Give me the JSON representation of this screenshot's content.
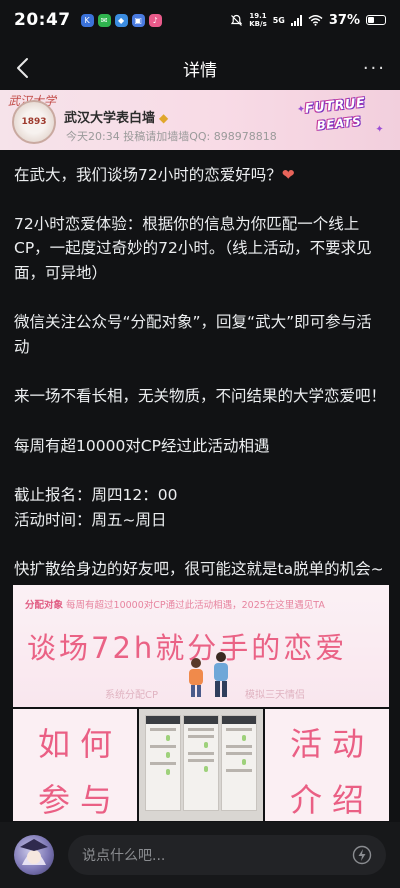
{
  "status_bar": {
    "time": "20:47",
    "net_speed_value": "19.1",
    "net_speed_unit": "KB/s",
    "network": "5G",
    "battery": "37%",
    "battery_level": 0.37
  },
  "nav": {
    "title": "详情",
    "more_label": "···"
  },
  "banner": {
    "account_name": "武汉大学表白墙",
    "meta": "今天20:34  投稿请加墙墙QQ: 898978818",
    "logo_line1": "FUTRUE",
    "logo_line2": "BEATS",
    "calligraphy": "武汉大学",
    "seal_text": "1893"
  },
  "post": {
    "p1": "在武大，我们谈场72小时的恋爱好吗？",
    "p1_emoji": "❤️",
    "p2": "72小时恋爱体验：根据你的信息为你匹配一个线上CP，一起度过奇妙的72小时。（线上活动，不要求见面，可异地）",
    "p3": "微信关注公众号“分配对象”，回复“武大”即可参与活动",
    "p4": "来一场不看长相，无关物质，不问结果的大学恋爱吧！",
    "p5": "每周有超10000对CP经过此活动相遇",
    "p6a": "截止报名：周四12：00",
    "p6b": "活动时间：周五~周日",
    "p7": "快扩散给身边的好友吧，很可能这就是ta脱单的机会~"
  },
  "images": {
    "wide_brand": "分配对象",
    "wide_top": "每周有超过10000对CP通过此活动相遇，2025在这里遇见TA",
    "wide_big": "谈场72h就分手的恋爱",
    "wide_sub1": "系统分配CP",
    "wide_sub2": "模拟三天情侣",
    "tile_how": "如何",
    "tile_join": "参与",
    "tile_act": "活动",
    "tile_intro": "介绍"
  },
  "comment_bar": {
    "placeholder": "说点什么吧..."
  },
  "colors": {
    "background": "#111214",
    "accent_pink": "#ea6285",
    "text": "#eceef0"
  },
  "icons": [
    "back-arrow-icon",
    "more-icon",
    "wifi-icon",
    "signal-icon",
    "battery-icon",
    "lightning-icon",
    "gem-icon",
    "heart-icon"
  ]
}
